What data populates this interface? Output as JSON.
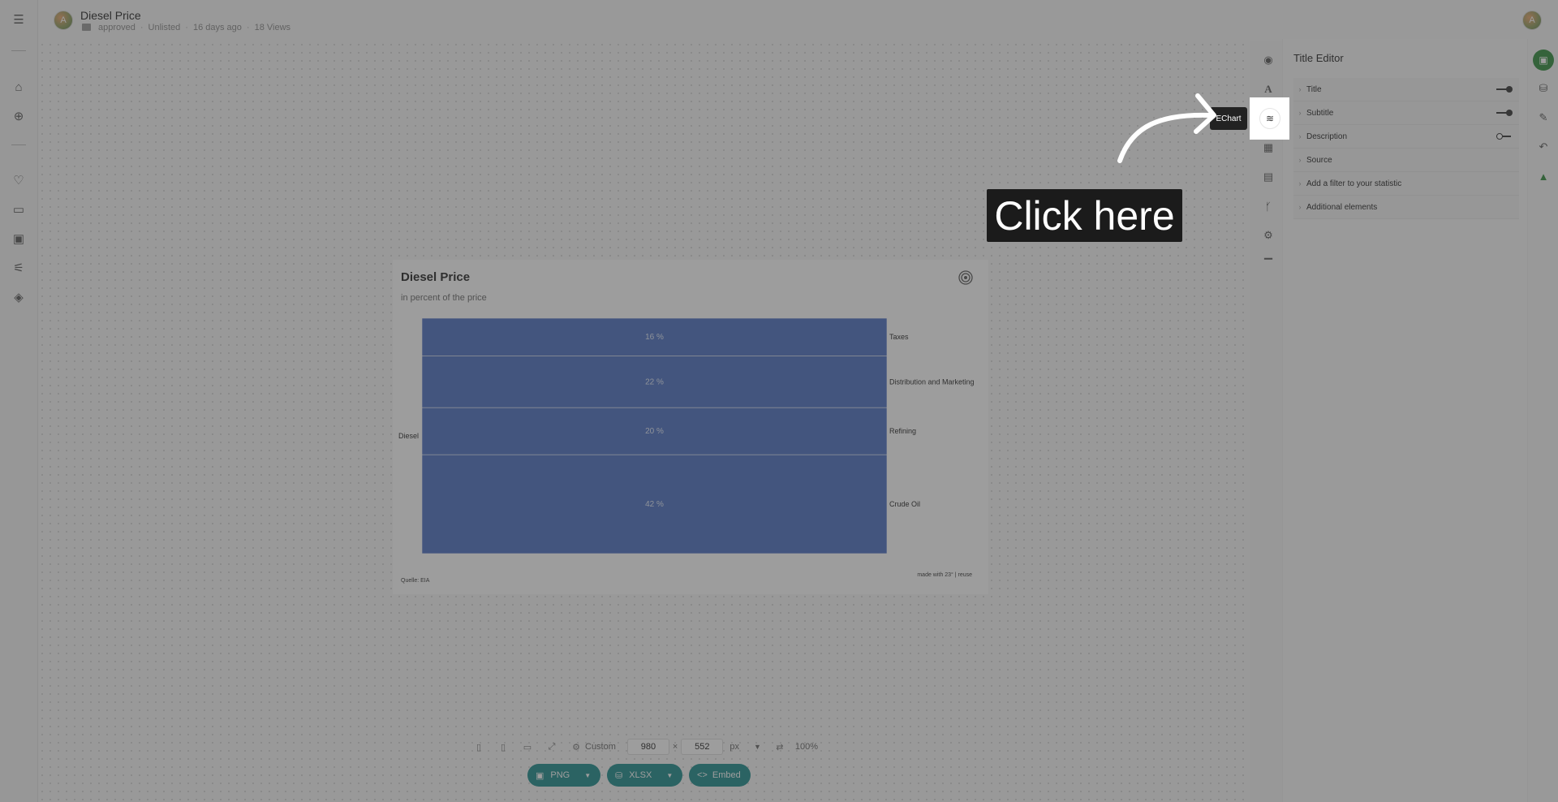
{
  "header": {
    "avatar_initial": "A",
    "doc_title": "Diesel Price",
    "status": "approved",
    "visibility": "Unlisted",
    "age": "16 days ago",
    "views": "18 Views"
  },
  "chart_data": {
    "type": "sankey",
    "title": "Diesel Price",
    "subtitle": "in percent of the price",
    "source_node": "Diesel",
    "targets": [
      "Taxes",
      "Distribution and Marketing",
      "Refining",
      "Crude Oil"
    ],
    "values": [
      16,
      22,
      20,
      42
    ],
    "value_labels": [
      "16 %",
      "22 %",
      "20 %",
      "42 %"
    ],
    "color": "#4a6fc0",
    "source_text": "Quelle: EIA",
    "made_with": "made with 23° | reuse"
  },
  "panel": {
    "title": "Title Editor",
    "items": [
      {
        "label": "Title",
        "toggle": "on"
      },
      {
        "label": "Subtitle",
        "toggle": "on"
      },
      {
        "label": "Description",
        "toggle": "off"
      },
      {
        "label": "Source"
      },
      {
        "label": "Add a filter to your statistic"
      },
      {
        "label": "Additional elements"
      }
    ]
  },
  "bottom": {
    "preset": "Custom",
    "width": "980",
    "times": "×",
    "height": "552",
    "unit": "px",
    "zoom": "100%",
    "png_label": "PNG",
    "xlsx_label": "XLSX",
    "embed_label": "Embed"
  },
  "overlay": {
    "tooltip": "EChart",
    "cta": "Click here"
  }
}
